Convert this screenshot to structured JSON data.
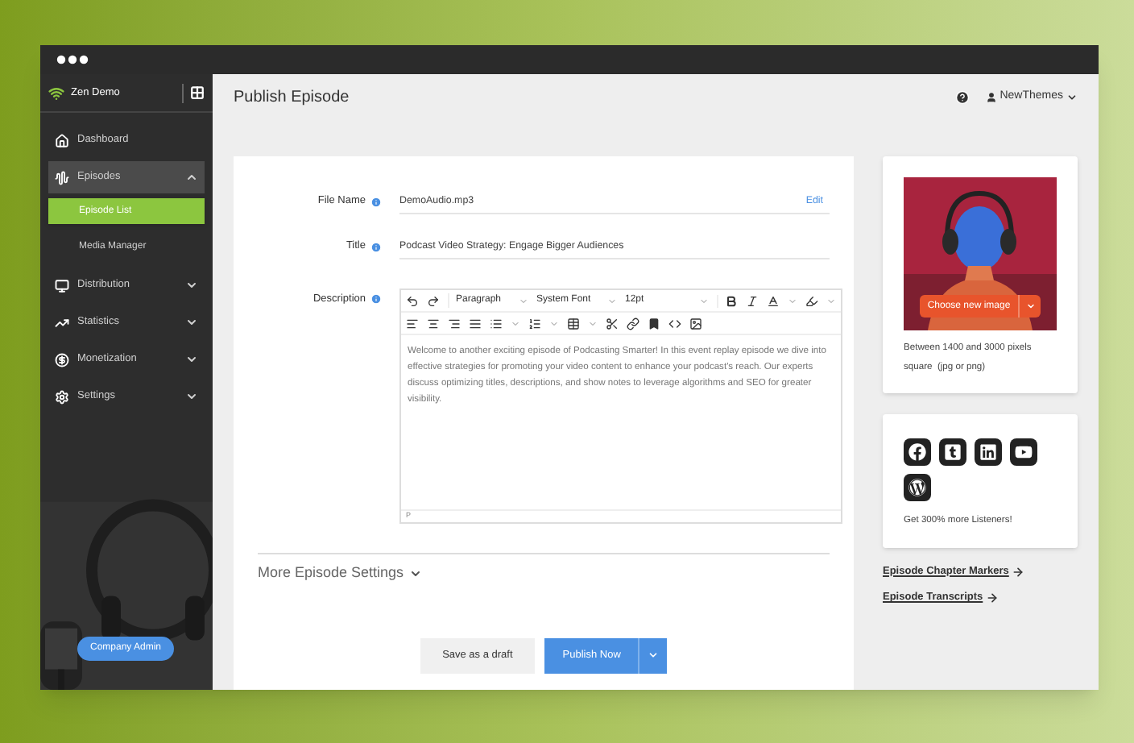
{
  "sidebar": {
    "brand": "Zen Demo",
    "items": [
      {
        "label": "Dashboard",
        "kind": "link",
        "expanded": false
      },
      {
        "label": "Episodes",
        "kind": "group",
        "expanded": true,
        "children": [
          {
            "label": "Episode List",
            "selected": true
          },
          {
            "label": "Media Manager",
            "selected": false
          }
        ]
      },
      {
        "label": "Distribution",
        "kind": "group",
        "expanded": false
      },
      {
        "label": "Statistics",
        "kind": "group",
        "expanded": false
      },
      {
        "label": "Monetization",
        "kind": "group",
        "expanded": false
      },
      {
        "label": "Settings",
        "kind": "group",
        "expanded": false
      }
    ],
    "admin_button": "Company Admin"
  },
  "header": {
    "title": "Publish Episode",
    "user": "NewThemes"
  },
  "form": {
    "fields": [
      {
        "label": "File Name",
        "value": "DemoAudio.mp3",
        "action": "Edit"
      },
      {
        "label": "Title",
        "value": "Podcast Video Strategy: Engage Bigger Audiences"
      }
    ],
    "description": {
      "label": "Description",
      "block": "Paragraph",
      "font": "System Font",
      "size": "12pt",
      "text": "Welcome to another exciting episode of Podcasting Smarter!  In this event replay episode we dive into effective strategies for promoting your video content to enhance your podcast's reach. Our experts discuss optimizing titles, descriptions, and show notes to leverage algorithms and SEO for greater visibility.",
      "path": "P"
    },
    "more_settings": "More Episode Settings",
    "buttons": {
      "draft": "Save as a draft",
      "publish": "Publish Now"
    }
  },
  "image_card": {
    "button": "Choose new image",
    "hint": "Between 1400 and 3000 pixels square  (jpg or png)"
  },
  "social_card": {
    "text": "Get 300% more Listeners!"
  },
  "links": [
    "Episode Chapter Markers",
    "Episode Transcripts"
  ]
}
